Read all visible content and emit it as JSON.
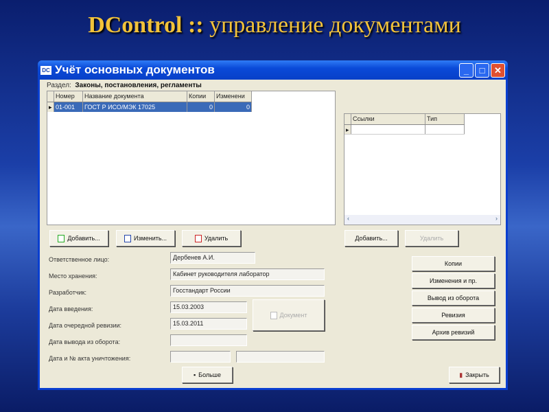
{
  "slide_title": {
    "brand": "DControl ::",
    "subtitle": "управление документами"
  },
  "window": {
    "title": "Учёт основных документов",
    "icon": "DC"
  },
  "section": {
    "label": "Раздел:",
    "value": "Законы, постановления, регламенты"
  },
  "documents_table": {
    "columns": [
      "Номер",
      "Название документа",
      "Копии",
      "Изменени"
    ],
    "rows": [
      {
        "number": "01-001",
        "name": "ГОСТ Р ИСО/МЭК 17025",
        "copies": "0",
        "changes": "0"
      }
    ]
  },
  "links_table": {
    "columns": [
      "Ссылки",
      "Тип"
    ]
  },
  "doc_buttons": {
    "add": "Добавить...",
    "edit": "Изменить...",
    "delete": "Удалить"
  },
  "link_buttons": {
    "add": "Добавить...",
    "delete": "Удалить"
  },
  "fields": {
    "responsible": {
      "label": "Ответственное лицо:",
      "value": "Дербенев А.И."
    },
    "storage": {
      "label": "Место хранения:",
      "value": "Кабинет руководителя лаборатор"
    },
    "developer": {
      "label": "Разработчик:",
      "value": "Госстандарт России"
    },
    "intro_date": {
      "label": "Дата введения:",
      "value": "15.03.2003"
    },
    "revision_date": {
      "label": "Дата очередной ревизии:",
      "value": "15.03.2011"
    },
    "withdraw_date": {
      "label": "Дата вывода из оборота:",
      "value": ""
    },
    "destroy": {
      "label": "Дата и № акта уничтожения:",
      "date": "",
      "number": ""
    }
  },
  "document_button": "Документ",
  "more_button": "Больше",
  "side_buttons": [
    "Копии",
    "Изменения и пр.",
    "Вывод из оборота",
    "Ревизия",
    "Архив ревизий"
  ],
  "close_button": "Закрыть"
}
